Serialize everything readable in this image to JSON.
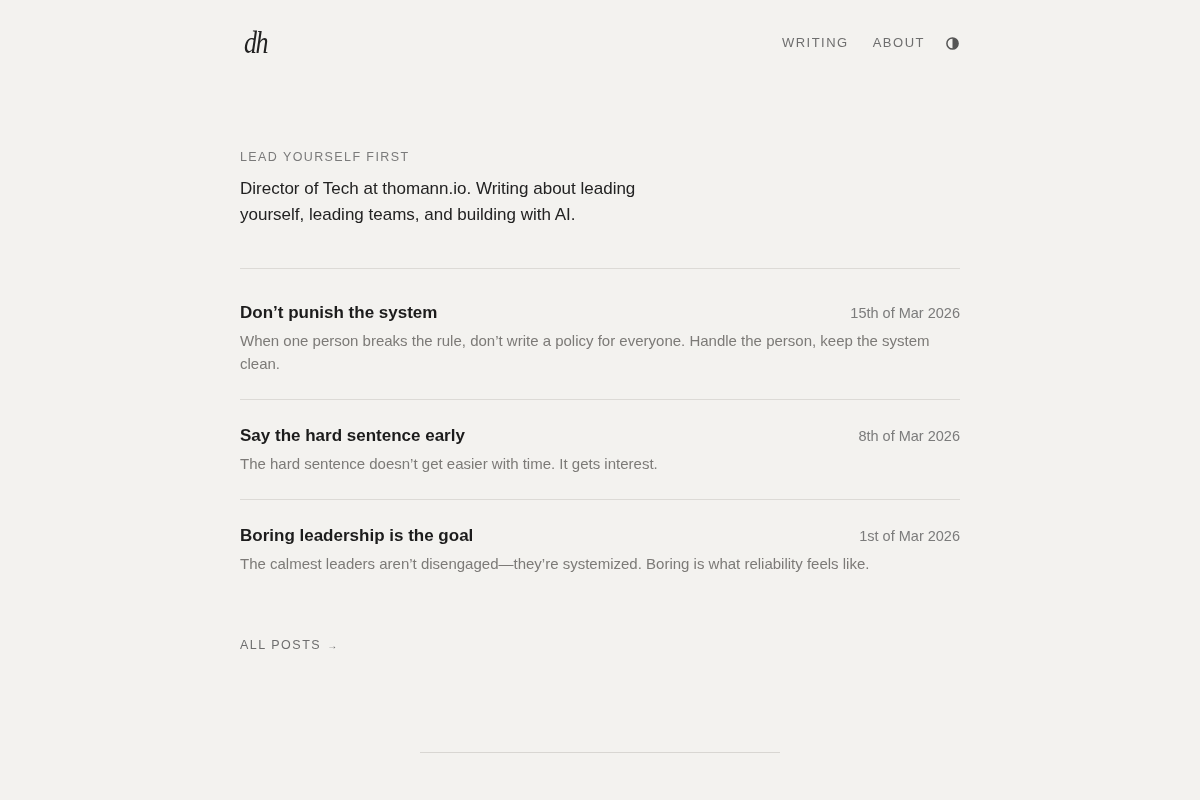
{
  "header": {
    "logo": "dh",
    "nav": [
      {
        "label": "WRITING"
      },
      {
        "label": "ABOUT"
      }
    ]
  },
  "intro": {
    "tagline": "LEAD YOURSELF FIRST",
    "text": "Director of Tech at thomann.io. Writing about leading yourself, leading teams, and building with AI."
  },
  "posts": [
    {
      "title": "Don’t punish the system",
      "date": "15th of Mar 2026",
      "excerpt": "When one person breaks the rule, don’t write a policy for everyone. Handle the person, keep the system clean."
    },
    {
      "title": "Say the hard sentence early",
      "date": "8th of Mar 2026",
      "excerpt": "The hard sentence doesn’t get easier with time. It gets interest."
    },
    {
      "title": "Boring leadership is the goal",
      "date": "1st of Mar 2026",
      "excerpt": "The calmest leaders aren’t disengaged—they’re systemized. Boring is what reliability feels like."
    }
  ],
  "all_posts_link": {
    "label": "ALL POSTS",
    "arrow": "→"
  }
}
